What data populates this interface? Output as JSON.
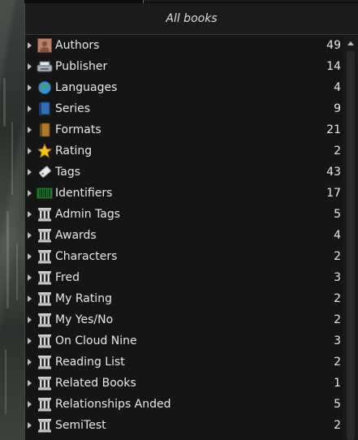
{
  "header": {
    "title": "All books"
  },
  "categories": [
    {
      "label": "Authors",
      "count": "49",
      "icon": "authors-icon"
    },
    {
      "label": "Publisher",
      "count": "14",
      "icon": "publisher-icon"
    },
    {
      "label": "Languages",
      "count": "4",
      "icon": "languages-icon"
    },
    {
      "label": "Series",
      "count": "9",
      "icon": "series-icon"
    },
    {
      "label": "Formats",
      "count": "21",
      "icon": "formats-icon"
    },
    {
      "label": "Rating",
      "count": "2",
      "icon": "rating-icon"
    },
    {
      "label": "Tags",
      "count": "43",
      "icon": "tags-icon"
    },
    {
      "label": "Identifiers",
      "count": "17",
      "icon": "identifiers-icon"
    },
    {
      "label": "Admin Tags",
      "count": "5",
      "icon": "column-icon"
    },
    {
      "label": "Awards",
      "count": "4",
      "icon": "column-icon"
    },
    {
      "label": "Characters",
      "count": "2",
      "icon": "column-icon"
    },
    {
      "label": "Fred",
      "count": "3",
      "icon": "column-icon"
    },
    {
      "label": "My Rating",
      "count": "2",
      "icon": "column-icon"
    },
    {
      "label": "My Yes/No",
      "count": "2",
      "icon": "column-icon"
    },
    {
      "label": "On Cloud Nine",
      "count": "3",
      "icon": "column-icon"
    },
    {
      "label": "Reading List",
      "count": "2",
      "icon": "column-icon"
    },
    {
      "label": "Related Books",
      "count": "1",
      "icon": "column-icon"
    },
    {
      "label": "Relationships Anded",
      "count": "5",
      "icon": "column-icon"
    },
    {
      "label": "SemiTest",
      "count": "2",
      "icon": "column-icon"
    }
  ]
}
